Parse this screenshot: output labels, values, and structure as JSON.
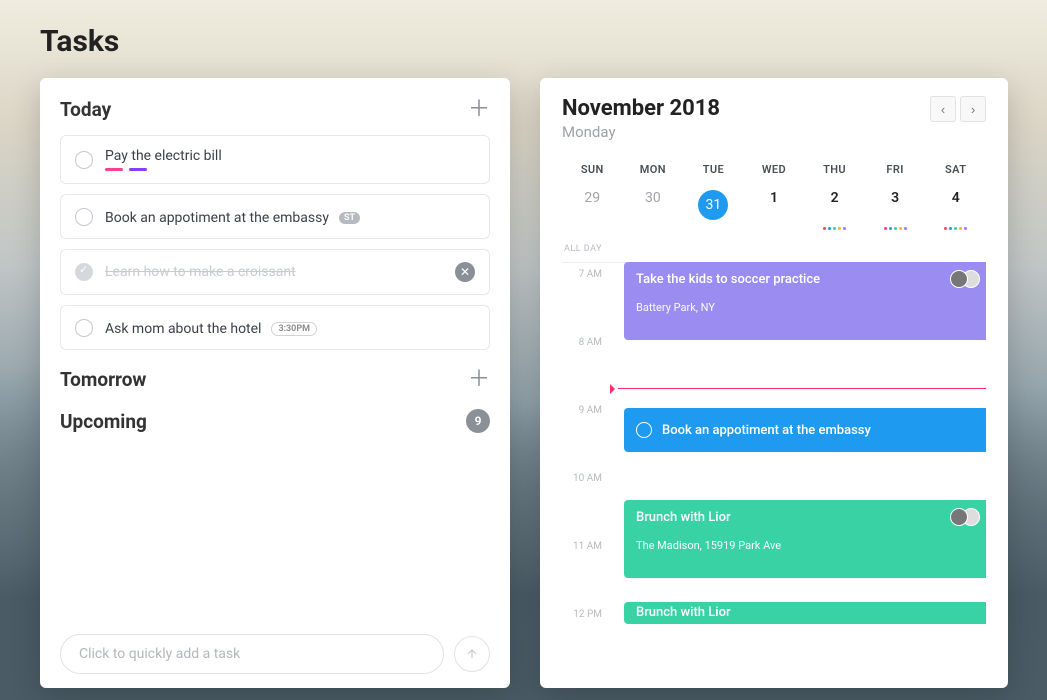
{
  "page": {
    "title": "Tasks"
  },
  "tasks": {
    "sections": {
      "today": {
        "title": "Today",
        "items": [
          {
            "title": "Pay the electric bill",
            "done": false,
            "tags": [
              "pink",
              "purple"
            ]
          },
          {
            "title": "Book an appotiment at the embassy",
            "done": false,
            "badge": "ST"
          },
          {
            "title": "Learn how to make a croissant",
            "done": true
          },
          {
            "title": "Ask mom about the hotel",
            "done": false,
            "time": "3:30PM"
          }
        ]
      },
      "tomorrow": {
        "title": "Tomorrow"
      },
      "upcoming": {
        "title": "Upcoming",
        "count": "9"
      }
    },
    "quick_add_placeholder": "Click to quickly add a task"
  },
  "calendar": {
    "title": "November 2018",
    "subtitle": "Monday",
    "dow": [
      "SUN",
      "MON",
      "TUE",
      "WED",
      "THU",
      "FRI",
      "SAT"
    ],
    "days": [
      {
        "num": "29",
        "muted": true
      },
      {
        "num": "30",
        "muted": true
      },
      {
        "num": "31",
        "selected": true
      },
      {
        "num": "1"
      },
      {
        "num": "2",
        "dots": [
          "red",
          "blue",
          "green",
          "orange",
          "purple"
        ]
      },
      {
        "num": "3",
        "dots": [
          "red",
          "blue",
          "green",
          "orange",
          "purple"
        ]
      },
      {
        "num": "4",
        "dots": [
          "red",
          "blue",
          "green",
          "orange",
          "purple"
        ]
      }
    ],
    "all_day_label": "ALL DAY",
    "hours": [
      "7 AM",
      "8 AM",
      "9 AM",
      "10 AM",
      "11 AM",
      "12 PM"
    ],
    "events": [
      {
        "title": "Take the kids to soccer practice",
        "sub": "Battery Park, NY",
        "class": "ev-purple",
        "avatars": true
      },
      {
        "title": "Book an appotiment at the embassy",
        "class": "ev-blue"
      },
      {
        "title": "Brunch with Lior",
        "sub": "The Madison, 15919 Park Ave",
        "class": "ev-green",
        "avatars": true
      },
      {
        "title": "Brunch with Lior",
        "class": "ev-green2"
      }
    ]
  }
}
